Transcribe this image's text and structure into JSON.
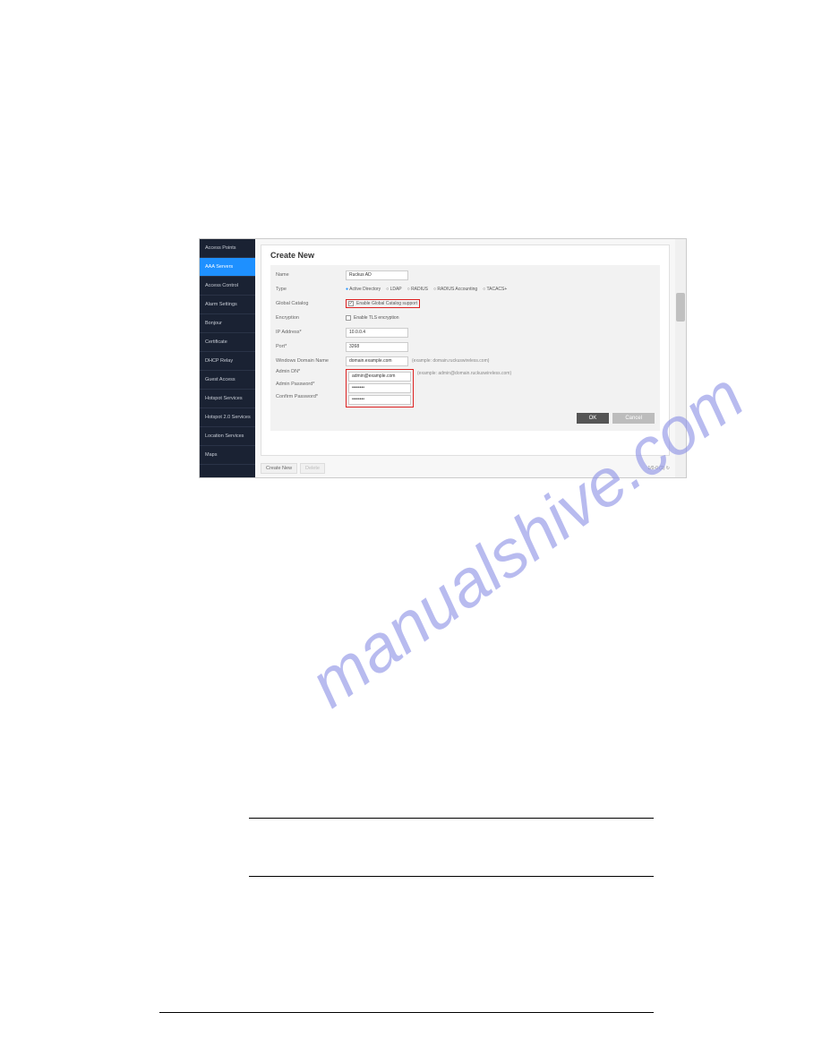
{
  "watermark": "manualshive.com",
  "sidebar": {
    "items": [
      {
        "label": "Access Points",
        "active": false
      },
      {
        "label": "AAA Servers",
        "active": true
      },
      {
        "label": "Access Control",
        "active": false
      },
      {
        "label": "Alarm Settings",
        "active": false
      },
      {
        "label": "Bonjour",
        "active": false
      },
      {
        "label": "Certificate",
        "active": false
      },
      {
        "label": "DHCP Relay",
        "active": false
      },
      {
        "label": "Guest Access",
        "active": false
      },
      {
        "label": "Hotspot Services",
        "active": false
      },
      {
        "label": "Hotspot 2.0 Services",
        "active": false
      },
      {
        "label": "Location Services",
        "active": false
      },
      {
        "label": "Maps",
        "active": false
      }
    ]
  },
  "panel": {
    "title": "Create New",
    "form": {
      "name_label": "Name",
      "name_value": "Ruckus AD",
      "type_label": "Type",
      "type_options": {
        "ad": "Active Directory",
        "ldap": "LDAP",
        "radius": "RADIUS",
        "radius_acct": "RADIUS Accounting",
        "tacacs": "TACACS+"
      },
      "global_catalog_label": "Global Catalog",
      "global_catalog_chk": "Enable Global Catalog support",
      "encryption_label": "Encryption",
      "encryption_chk": "Enable TLS encryption",
      "ip_label": "IP Address*",
      "ip_value": "10.0.0.4",
      "port_label": "Port*",
      "port_value": "3268",
      "domain_label": "Windows Domain Name",
      "domain_value": "domain.example.com",
      "domain_hint": "(example: domain.ruckuswireless.com)",
      "admin_dn_label": "Admin DN*",
      "admin_dn_value": "admin@example.com",
      "admin_dn_hint": "(example: admin@domain.ruckuswireless.com)",
      "admin_pw_label": "Admin Password*",
      "admin_pw_value": "••••••••",
      "confirm_pw_label": "Confirm Password*",
      "confirm_pw_value": "••••••••"
    },
    "buttons": {
      "ok": "OK",
      "cancel": "Cancel"
    },
    "below": {
      "create_new": "Create New",
      "delete": "Delete",
      "version": "1/0-0 (1) ↻"
    }
  }
}
